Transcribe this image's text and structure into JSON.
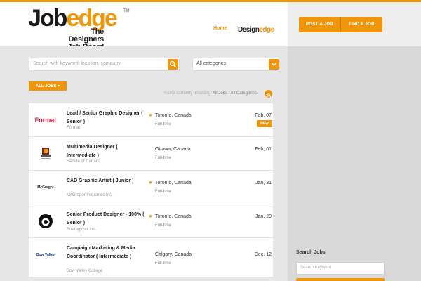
{
  "header": {
    "logo": {
      "main_a": "Job",
      "main_b": "edge",
      "tm": "TM",
      "tagline": "The Designers Job Board"
    },
    "nav": {
      "home": "Home",
      "brand_a": "Design",
      "brand_b": "edge"
    },
    "buttons": {
      "post": "POST A JOB",
      "find": "FIND A JOB"
    }
  },
  "search": {
    "placeholder": "Search with keyword, location, company",
    "category": "All categories"
  },
  "filter": {
    "tab": "ALL JOBS ▾",
    "browsing_prefix": "You're currently browsing:",
    "browsing_value": "All Jobs / All Categories"
  },
  "jobs": [
    {
      "logo": "Format",
      "title": "Lead / Senior Graphic Designer ( Senior )",
      "company": "Format",
      "location": "Toronto, Canada",
      "type": "Full-time",
      "date": "Feb, 07",
      "badge": "NEW"
    },
    {
      "logo": "",
      "title": "Multimedia Designer ( Intermediate )",
      "company": "Senate of Canada",
      "location": "Ottawa, Canada",
      "type": "Full-time",
      "date": "Feb, 01",
      "badge": ""
    },
    {
      "logo": "McGregor",
      "title": "CAD Graphic Artist ( Junior )",
      "company": "McGregor Industries Inc.",
      "location": "Toronto, Canada",
      "type": "Full-time",
      "date": "Jan, 31",
      "badge": ""
    },
    {
      "logo": "",
      "title": "Senior Product Designer - 100% ( Senior )",
      "company": "Strategyzer Inc.",
      "location": "Toronto, Canada",
      "type": "Full-time",
      "date": "Jan, 29",
      "badge": ""
    },
    {
      "logo": "Bow Valley",
      "title": "Campaign Marketing & Media Coordinator ( Intermediate )",
      "company": "Bow Valley College",
      "location": "Calgary, Canada",
      "type": "Full-time",
      "date": "Dec, 12",
      "badge": ""
    }
  ],
  "sidebar": {
    "search_title": "Search Jobs",
    "search_placeholder": "Search Keyword"
  },
  "colors": {
    "accent": "#f0960c"
  }
}
